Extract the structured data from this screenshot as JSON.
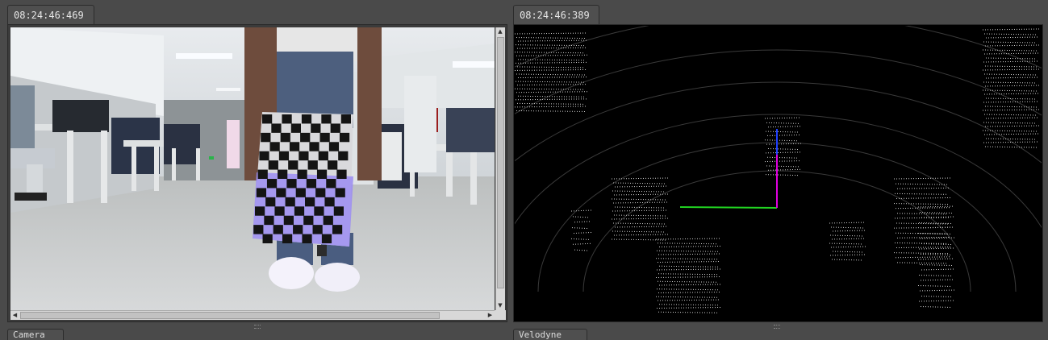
{
  "panels": {
    "camera": {
      "timestamp": "08:24:46:469",
      "bottom_tab": "Camera"
    },
    "lidar": {
      "timestamp": "08:24:46:389",
      "bottom_tab": "Velodyne"
    }
  },
  "scrollbars": {
    "up_arrow": "▲",
    "down_arrow": "▼",
    "left_arrow": "◀",
    "right_arrow": "▶"
  },
  "colors": {
    "axis_x": "#21d321",
    "axis_y": "#e000e0",
    "axis_z": "#2040ff",
    "checkerboard": "#141414",
    "board_tint": "#9b8cf2"
  }
}
